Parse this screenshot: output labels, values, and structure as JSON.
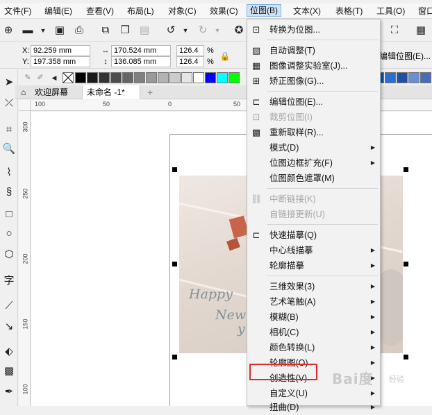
{
  "menubar": {
    "items": [
      {
        "label": "文件(F)"
      },
      {
        "label": "编辑(E)"
      },
      {
        "label": "查看(V)"
      },
      {
        "label": "布局(L)"
      },
      {
        "label": "对象(C)"
      },
      {
        "label": "效果(C)"
      },
      {
        "label": "位图(B)"
      },
      {
        "label": "文本(X)"
      },
      {
        "label": "表格(T)"
      },
      {
        "label": "工具(O)"
      },
      {
        "label": "窗口"
      }
    ]
  },
  "propbar": {
    "x_label": "X:",
    "x_value": "92.259 mm",
    "y_label": "Y:",
    "y_value": "197.358 mm",
    "width_value": "170.524 mm",
    "height_value": "136.085 mm",
    "scale_x": "126.4",
    "scale_y": "126.4",
    "pct": "%",
    "edit_bitmap_label": "编辑位图(E)..."
  },
  "tabs": {
    "welcome": "欢迎屏幕",
    "document": "未命名 -1*",
    "add": "+"
  },
  "rulers": {
    "h_ticks": [
      "100",
      "50",
      "0",
      "50"
    ],
    "v_ticks": [
      "300",
      "250",
      "200",
      "150",
      "100"
    ]
  },
  "photo": {
    "text1": "Happy",
    "text2": "New",
    "text3": "y"
  },
  "bitmap_menu": {
    "items": [
      {
        "label": "转换为位图...",
        "icon": "convert-bitmap-icon",
        "disabled": false,
        "submenu": false
      },
      {
        "label": "自动调整(T)",
        "icon": "auto-adjust-icon",
        "disabled": false,
        "submenu": false
      },
      {
        "label": "图像调整实验室(J)...",
        "icon": "image-lab-icon",
        "disabled": false,
        "submenu": false
      },
      {
        "label": "矫正图像(G)...",
        "icon": "straighten-icon",
        "disabled": false,
        "submenu": false
      },
      {
        "label": "编辑位图(E)...",
        "icon": "edit-bitmap-icon",
        "disabled": false,
        "submenu": false
      },
      {
        "label": "裁剪位图(I)",
        "icon": "crop-bitmap-icon",
        "disabled": true,
        "submenu": false
      },
      {
        "label": "重新取样(R)...",
        "icon": "resample-icon",
        "disabled": false,
        "submenu": false
      },
      {
        "label": "模式(D)",
        "icon": "",
        "disabled": false,
        "submenu": true
      },
      {
        "label": "位图边框扩充(F)",
        "icon": "",
        "disabled": false,
        "submenu": true
      },
      {
        "label": "位图颜色遮罩(M)",
        "icon": "",
        "disabled": false,
        "submenu": false
      },
      {
        "label": "中断链接(K)",
        "icon": "break-link-icon",
        "disabled": true,
        "submenu": false
      },
      {
        "label": "自链接更新(U)",
        "icon": "",
        "disabled": true,
        "submenu": false
      },
      {
        "label": "快速描摹(Q)",
        "icon": "quick-trace-icon",
        "disabled": false,
        "submenu": false
      },
      {
        "label": "中心线描摹",
        "icon": "",
        "disabled": false,
        "submenu": true
      },
      {
        "label": "轮廓描摹",
        "icon": "",
        "disabled": false,
        "submenu": true
      },
      {
        "label": "三维效果(3)",
        "icon": "",
        "disabled": false,
        "submenu": true
      },
      {
        "label": "艺术笔触(A)",
        "icon": "",
        "disabled": false,
        "submenu": true
      },
      {
        "label": "模糊(B)",
        "icon": "",
        "disabled": false,
        "submenu": true
      },
      {
        "label": "相机(C)",
        "icon": "",
        "disabled": false,
        "submenu": true
      },
      {
        "label": "颜色转换(L)",
        "icon": "",
        "disabled": false,
        "submenu": true
      },
      {
        "label": "轮廓图(O)",
        "icon": "",
        "disabled": false,
        "submenu": true
      },
      {
        "label": "创造性(V)",
        "icon": "",
        "disabled": false,
        "submenu": true
      },
      {
        "label": "自定义(U)",
        "icon": "",
        "disabled": false,
        "submenu": true
      },
      {
        "label": "扭曲(D)",
        "icon": "",
        "disabled": false,
        "submenu": true
      }
    ]
  },
  "watermark": {
    "text": "Bai度",
    "sub": "经验"
  },
  "colors": {
    "accent": "#cfe3f7",
    "highlight": "#e02a2a",
    "palette": [
      "#000000",
      "#1a1a1a",
      "#333333",
      "#4d4d4d",
      "#666666",
      "#808080",
      "#999999",
      "#b3b3b3",
      "#cccccc",
      "#e6e6e6",
      "#ffffff",
      "#0000ff",
      "#00ffff",
      "#00ff00"
    ],
    "palette_right": [
      "#003399",
      "#0055aa",
      "#2a6fcf",
      "#1f4fa6",
      "#6a8fd0",
      "#4a6cb8"
    ]
  }
}
